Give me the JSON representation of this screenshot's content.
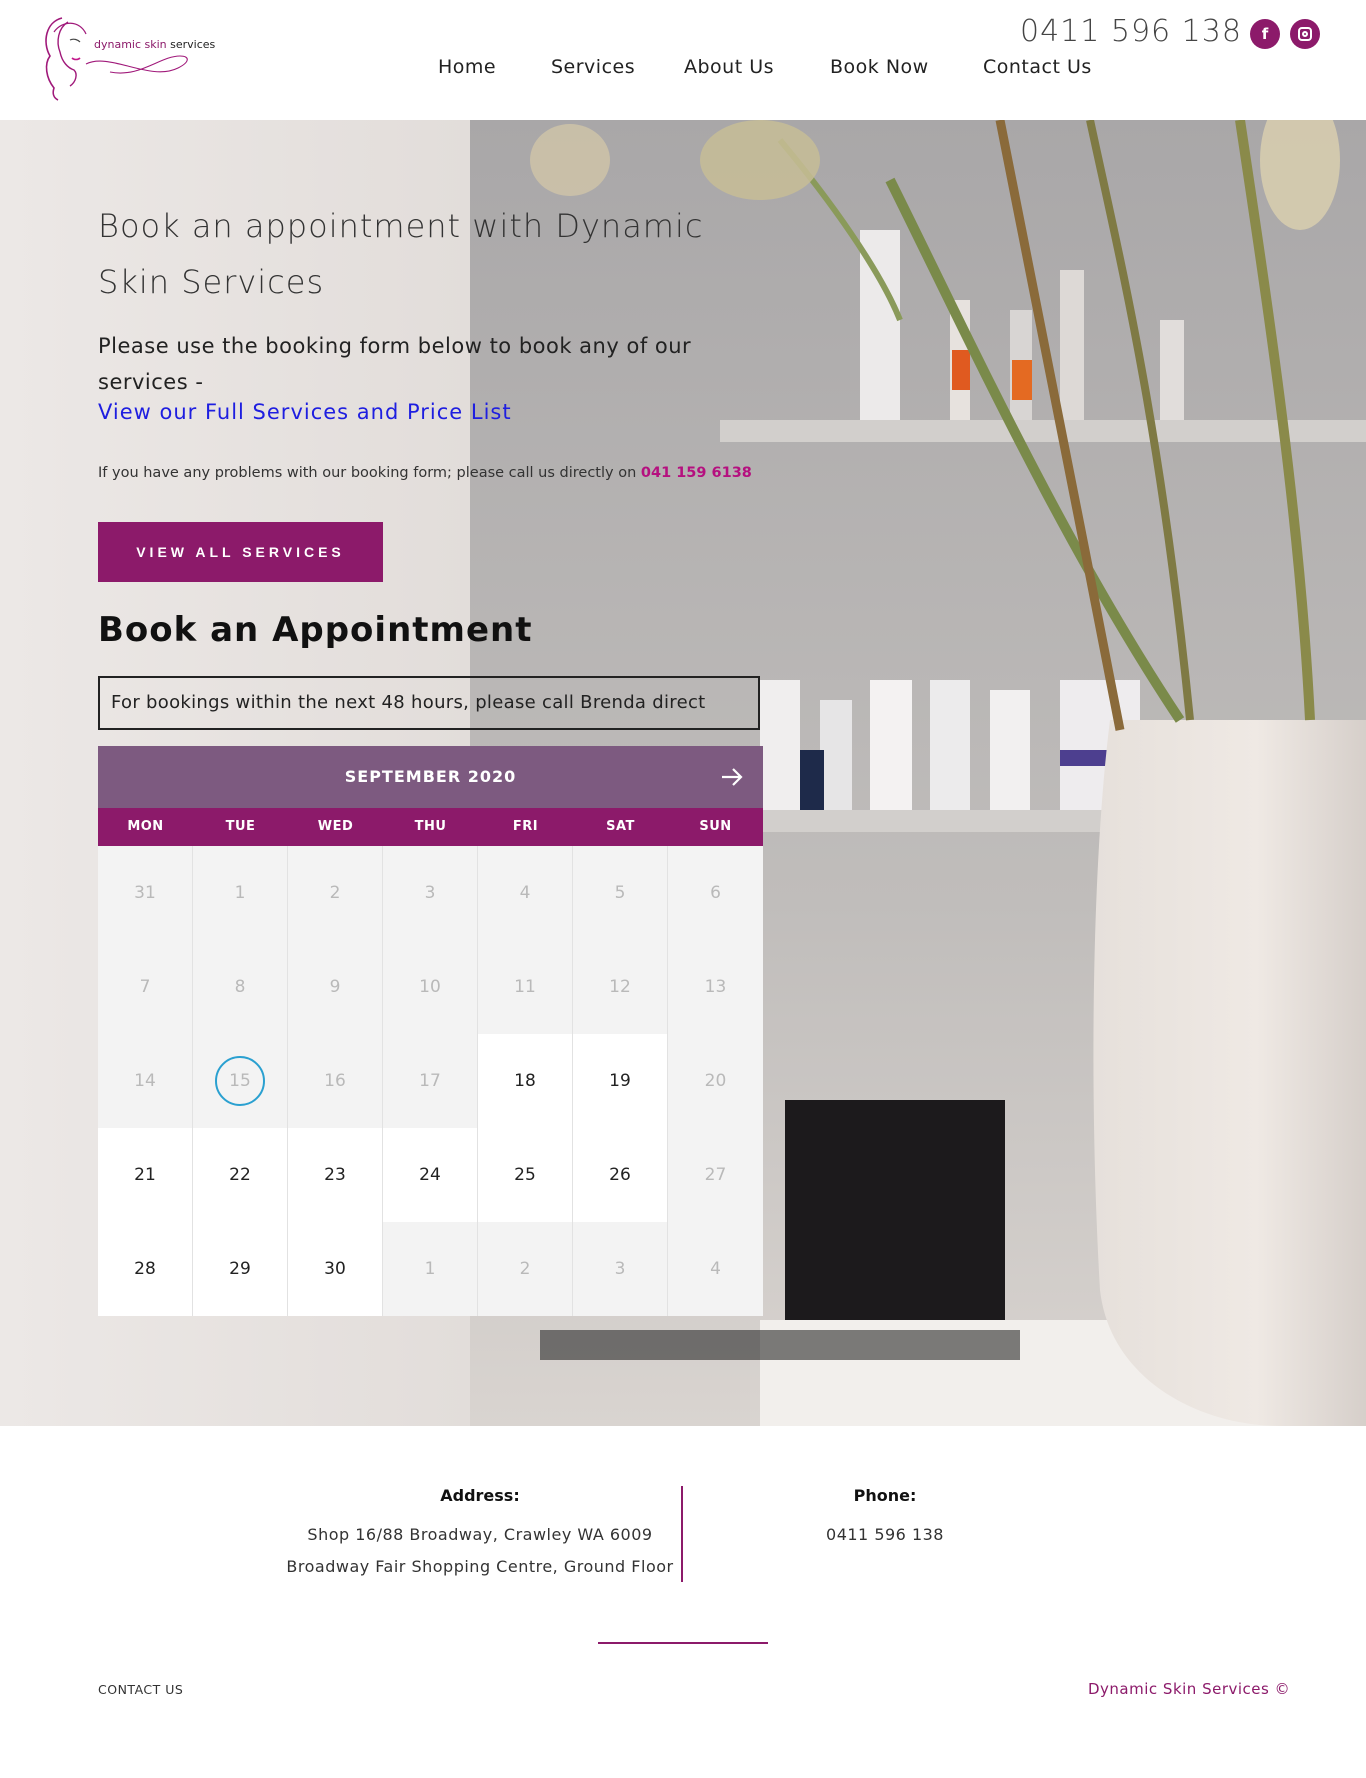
{
  "brand": {
    "logo_text_accent": "dynamic skin",
    "logo_text_rest": " services",
    "accent_color": "#8c1a6a"
  },
  "header": {
    "phone": "0411 596 138",
    "social": [
      "facebook-icon",
      "instagram-icon"
    ],
    "nav": [
      "Home",
      "Services",
      "About Us",
      "Book Now",
      "Contact Us"
    ]
  },
  "hero": {
    "title": "Book an appointment with Dynamic Skin Services",
    "intro": "Please use the booking form below to book any of our services -",
    "price_link": "View our Full Services and Price List",
    "note_text": "If you have any problems with our booking form; please call us directly on ",
    "note_phone": "041 159 6138",
    "button": "VIEW ALL SERVICES",
    "booking_title": "Book an Appointment",
    "notice": "For bookings within the next 48 hours, please call Brenda direct"
  },
  "calendar": {
    "month": "SEPTEMBER 2020",
    "weekdays": [
      "MON",
      "TUE",
      "WED",
      "THU",
      "FRI",
      "SAT",
      "SUN"
    ],
    "today": "15",
    "days": [
      {
        "d": "31",
        "on": false
      },
      {
        "d": "1",
        "on": false
      },
      {
        "d": "2",
        "on": false
      },
      {
        "d": "3",
        "on": false
      },
      {
        "d": "4",
        "on": false
      },
      {
        "d": "5",
        "on": false
      },
      {
        "d": "6",
        "on": false
      },
      {
        "d": "7",
        "on": false
      },
      {
        "d": "8",
        "on": false
      },
      {
        "d": "9",
        "on": false
      },
      {
        "d": "10",
        "on": false
      },
      {
        "d": "11",
        "on": false
      },
      {
        "d": "12",
        "on": false
      },
      {
        "d": "13",
        "on": false
      },
      {
        "d": "14",
        "on": false
      },
      {
        "d": "15",
        "on": false,
        "today": true
      },
      {
        "d": "16",
        "on": false
      },
      {
        "d": "17",
        "on": false
      },
      {
        "d": "18",
        "on": true
      },
      {
        "d": "19",
        "on": true
      },
      {
        "d": "20",
        "on": false
      },
      {
        "d": "21",
        "on": true
      },
      {
        "d": "22",
        "on": true
      },
      {
        "d": "23",
        "on": true
      },
      {
        "d": "24",
        "on": true
      },
      {
        "d": "25",
        "on": true
      },
      {
        "d": "26",
        "on": true
      },
      {
        "d": "27",
        "on": false
      },
      {
        "d": "28",
        "on": true
      },
      {
        "d": "29",
        "on": true
      },
      {
        "d": "30",
        "on": true
      },
      {
        "d": "1",
        "on": false
      },
      {
        "d": "2",
        "on": false
      },
      {
        "d": "3",
        "on": false
      },
      {
        "d": "4",
        "on": false
      }
    ]
  },
  "footer": {
    "address_label": "Address:",
    "address_line1": "Shop 16/88 Broadway, Crawley WA 6009",
    "address_line2": "Broadway Fair Shopping Centre, Ground Floor",
    "phone_label": "Phone:",
    "phone": "0411 596 138",
    "contact_link": "CONTACT US",
    "copyright": "Dynamic Skin Services ©"
  }
}
